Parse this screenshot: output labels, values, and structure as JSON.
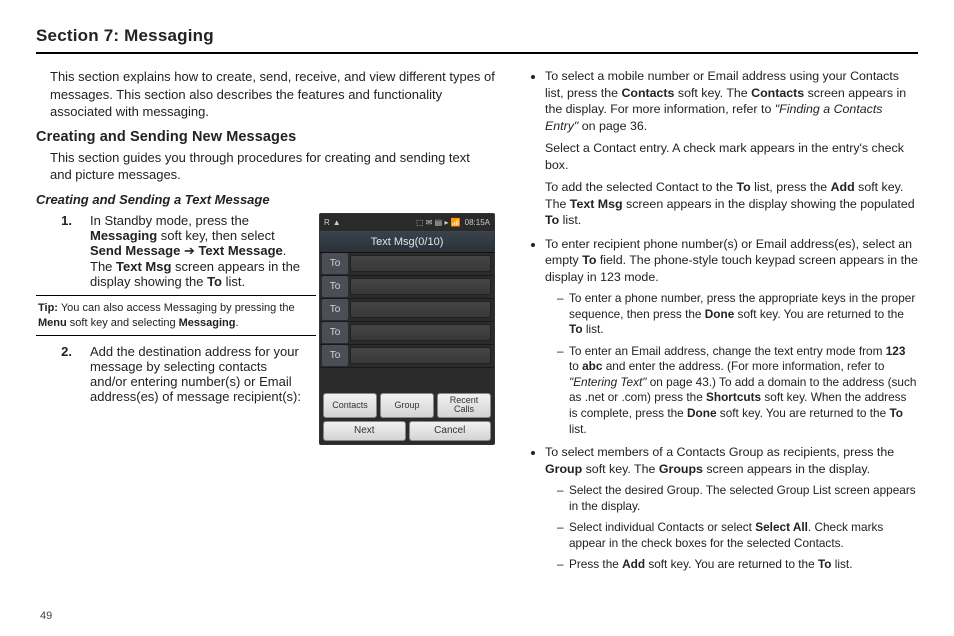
{
  "section_title": "Section 7: Messaging",
  "intro": "This section explains how to create, send, receive, and view different types of messages. This section also describes the features and functionality associated with messaging.",
  "h2_creating": "Creating and Sending New Messages",
  "creating_intro": "This section guides you through procedures for creating and sending text and picture messages.",
  "h3_text_msg": "Creating and Sending a Text Message",
  "step1": {
    "num": "1.",
    "frag1": "In Standby mode, press the ",
    "b_messaging": "Messaging",
    "frag2": " soft key, then select ",
    "b_send": "Send Message",
    "arrow": " ➔ ",
    "b_textmsg": "Text Message",
    "frag3": ". The ",
    "b_textmsg2": "Text Msg",
    "frag4": " screen appears in the display showing the ",
    "b_to": "To",
    "frag5": " list."
  },
  "tip": {
    "label": "Tip:",
    "frag1": " You can also access Messaging by pressing the ",
    "b_menu": "Menu",
    "frag2": " soft key and selecting ",
    "b_messaging": "Messaging",
    "frag3": "."
  },
  "step2": {
    "num": "2.",
    "text": "Add the destination address for your message by selecting contacts and/or entering number(s) or Email address(es) of message recipient(s):"
  },
  "right": {
    "b1": {
      "frag1": "To select a mobile number or Email address using your Contacts list, press the ",
      "b_contacts": "Contacts",
      "frag2": " soft key. The ",
      "b_contacts2": "Contacts",
      "frag3": " screen appears in the display. For more information, refer to ",
      "i_finding": "\"Finding a Contacts Entry\"",
      "frag4": "  on page 36.",
      "sub1": "Select a Contact entry. A check mark appears in the entry's check box.",
      "sub2_f1": "To add the selected Contact to the ",
      "sub2_b_to": "To",
      "sub2_f2": " list, press the ",
      "sub2_b_add": "Add",
      "sub2_f3": " soft key. The ",
      "sub2_b_textmsg": "Text Msg",
      "sub2_f4": " screen appears in the display showing the populated ",
      "sub2_b_to2": "To",
      "sub2_f5": " list."
    },
    "b2": {
      "f1": "To enter recipient phone number(s) or Email address(es), select an empty ",
      "b_to": "To",
      "f2": " field. The phone-style touch keypad screen appears in the display in 123 mode.",
      "d1_f1": "To enter a phone number, press the appropriate keys in the proper sequence, then press the ",
      "d1_b_done": "Done",
      "d1_f2": " soft key. You are returned to the ",
      "d1_b_to": "To",
      "d1_f3": " list.",
      "d2_f1": "To enter an Email address, change the text entry mode from ",
      "d2_b_123": "123",
      "d2_f2": " to ",
      "d2_b_abc": "abc",
      "d2_f3": " and enter the address. (For more information, refer to ",
      "d2_i_entering": "\"Entering Text\"",
      "d2_f4": "  on page 43.) To add a domain to the address (such as .net or .com) press the ",
      "d2_b_shortcuts": "Shortcuts",
      "d2_f5": " soft key. When the address is complete, press the ",
      "d2_b_done": "Done",
      "d2_f6": " soft key. You are returned to the ",
      "d2_b_to": "To",
      "d2_f7": " list."
    },
    "b3": {
      "f1": "To select members of a Contacts Group as recipients, press the ",
      "b_group": "Group",
      "f2": " soft key. The ",
      "b_groups": "Groups",
      "f3": " screen appears in the display.",
      "d1": "Select the desired Group. The selected Group List screen appears in the display.",
      "d2_f1": "Select individual Contacts or select ",
      "d2_b_selectall": "Select All",
      "d2_f2": ". Check marks appear in the check boxes for the selected Contacts.",
      "d3_f1": "Press the ",
      "d3_b_add": "Add",
      "d3_f2": " soft key. You are returned to the ",
      "d3_b_to": "To",
      "d3_f3": " list."
    }
  },
  "page_num": "49",
  "phone": {
    "time": "08:15A",
    "status_icons": "⬚ ✉   ▤ ▸  📶",
    "title": "Text Msg(0/10)",
    "to": "To",
    "tabs": {
      "contacts": "Contacts",
      "group": "Group",
      "recent": "Recent\nCalls"
    },
    "soft": {
      "next": "Next",
      "cancel": "Cancel"
    }
  }
}
